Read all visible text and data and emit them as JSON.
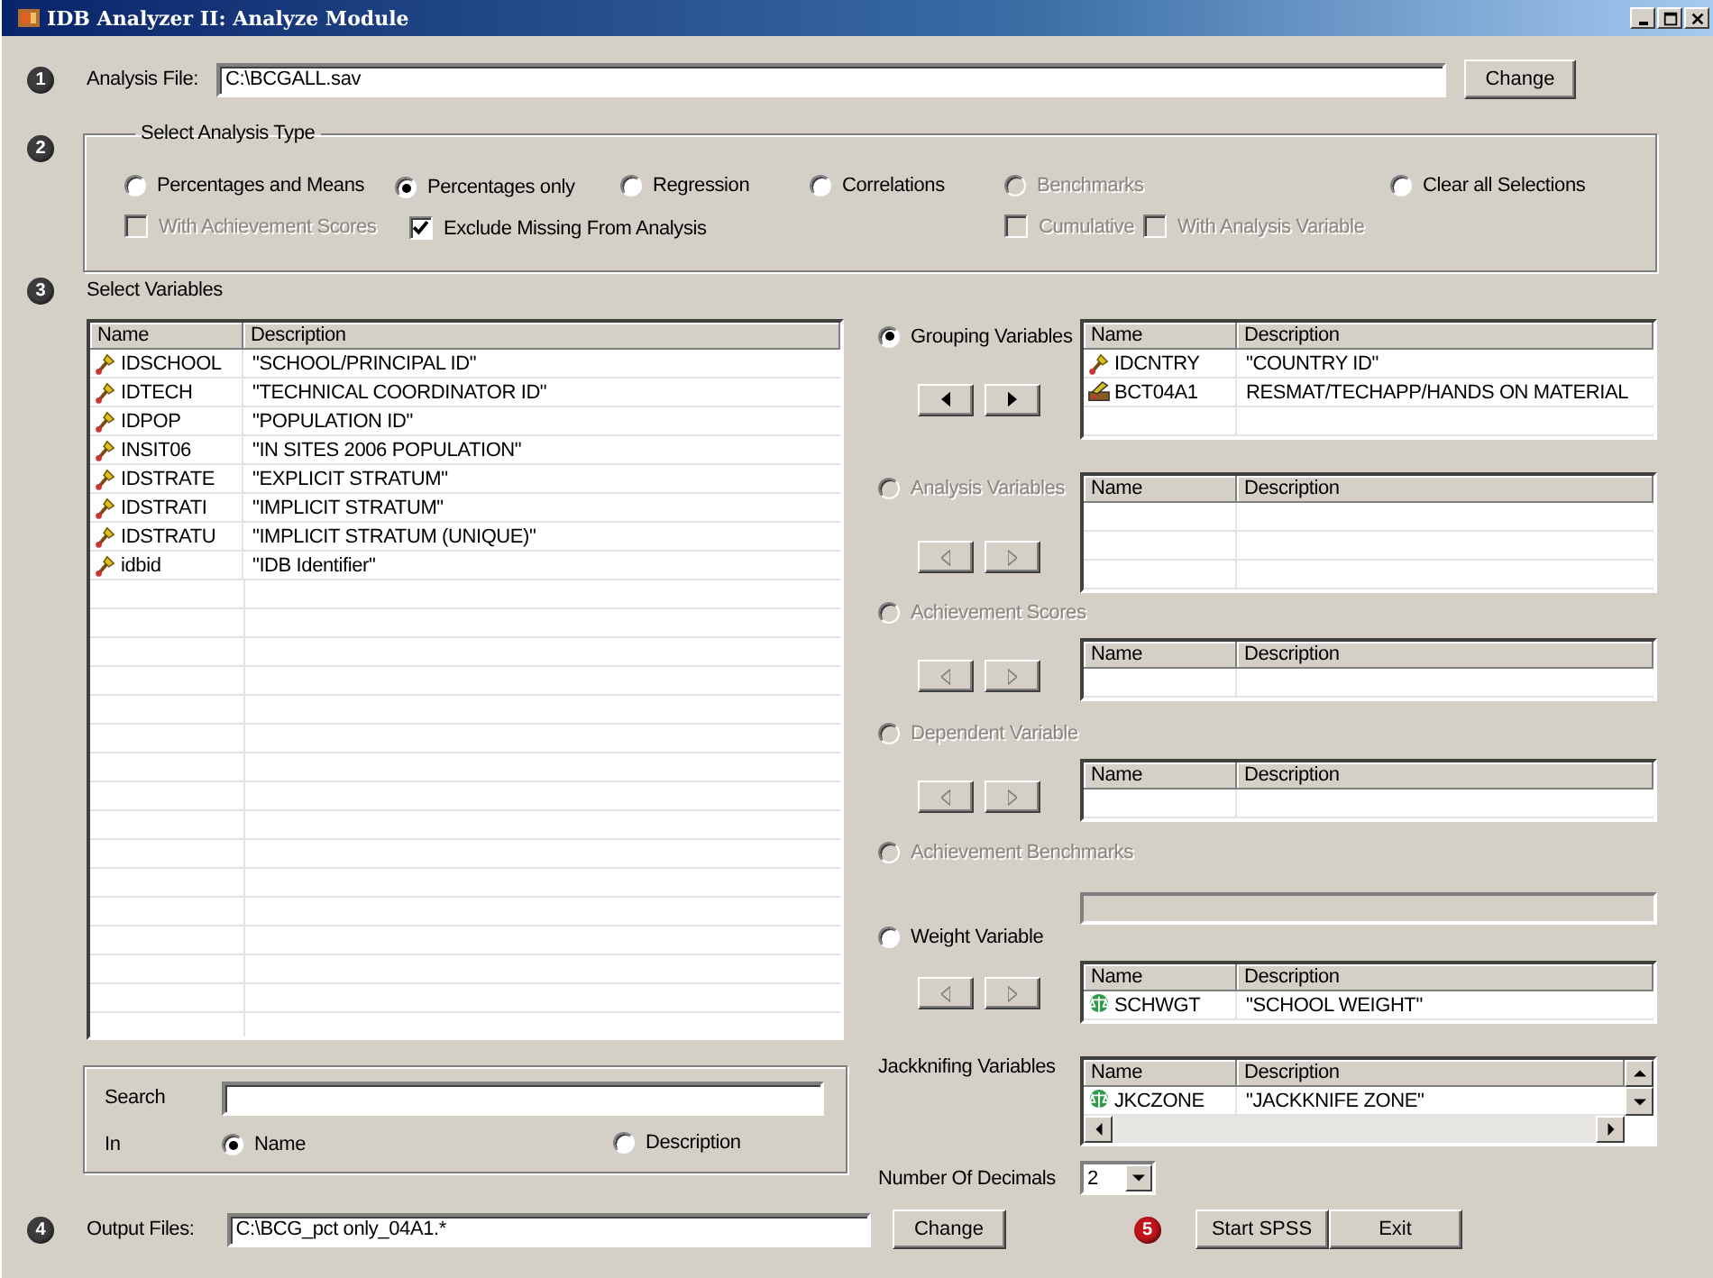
{
  "window": {
    "title": "IDB Analyzer II: Analyze Module"
  },
  "analysis_file": {
    "step": {
      "number": "1",
      "color": "#3c3c3c"
    },
    "label": "Analysis File:",
    "value": "C:\\BCGALL.sav",
    "button": "Change"
  },
  "analysis_type": {
    "step": {
      "number": "2",
      "color": "#3c3c3c"
    },
    "title": "Select Analysis Type",
    "options": [
      {
        "label": "Percentages and Means",
        "selected": false,
        "disabled": false
      },
      {
        "label": "Percentages only",
        "selected": true,
        "disabled": false
      },
      {
        "label": "Regression",
        "selected": false,
        "disabled": false
      },
      {
        "label": "Correlations",
        "selected": false,
        "disabled": false
      },
      {
        "label": "Benchmarks",
        "selected": false,
        "disabled": true
      },
      {
        "label": "Clear all Selections",
        "selected": false,
        "disabled": false
      }
    ],
    "checkboxes": [
      {
        "label": "With Achievement Scores",
        "checked": false,
        "disabled": true
      },
      {
        "label": "Exclude Missing From Analysis",
        "checked": true,
        "disabled": false
      },
      {
        "label": "Cumulative",
        "checked": false,
        "disabled": true
      },
      {
        "label": "With Analysis Variable",
        "checked": false,
        "disabled": true
      }
    ]
  },
  "select_variables": {
    "step": {
      "number": "3",
      "color": "#3c3c3c"
    },
    "title": "Select Variables",
    "columns": [
      "Name",
      "Description"
    ],
    "rows": [
      {
        "name": "IDSCHOOL",
        "description": "\"SCHOOL/PRINCIPAL ID\"",
        "kind": "id"
      },
      {
        "name": "IDTECH",
        "description": "\"TECHNICAL COORDINATOR ID\"",
        "kind": "id"
      },
      {
        "name": "IDPOP",
        "description": "\"POPULATION ID\"",
        "kind": "id"
      },
      {
        "name": "INSIT06",
        "description": "\"IN SITES 2006 POPULATION\"",
        "kind": "id"
      },
      {
        "name": "IDSTRATE",
        "description": "\"EXPLICIT STRATUM\"",
        "kind": "id"
      },
      {
        "name": "IDSTRATI",
        "description": "\"IMPLICIT STRATUM\"",
        "kind": "id"
      },
      {
        "name": "IDSTRATU",
        "description": "\"IMPLICIT STRATUM (UNIQUE)\"",
        "kind": "id"
      },
      {
        "name": "idbid",
        "description": "\"IDB Identifier\"",
        "kind": "id"
      }
    ],
    "search": {
      "label": "Search",
      "in_label": "In",
      "options": [
        {
          "label": "Name",
          "selected": true
        },
        {
          "label": "Description",
          "selected": false
        }
      ]
    }
  },
  "variable_groups": [
    {
      "kind": "table",
      "label": "Grouping Variables",
      "selected": true,
      "disabled": false,
      "columns": [
        "Name",
        "Description"
      ],
      "rows": [
        {
          "name": "IDCNTRY",
          "description": "\"COUNTRY ID\"",
          "kind": "id"
        },
        {
          "name": "BCT04A1",
          "description": "RESMAT/TECHAPP/HANDS ON MATERIAL",
          "kind": "categorical"
        }
      ]
    },
    {
      "kind": "table",
      "label": "Analysis Variables",
      "selected": false,
      "disabled": true,
      "columns": [
        "Name",
        "Description"
      ]
    },
    {
      "kind": "table",
      "label": "Achievement Scores",
      "selected": false,
      "disabled": true,
      "columns": [
        "Name",
        "Description"
      ]
    },
    {
      "kind": "table",
      "label": "Dependent Variable",
      "selected": false,
      "disabled": true,
      "columns": [
        "Name",
        "Description"
      ]
    },
    {
      "kind": "field",
      "label": "Achievement Benchmarks",
      "selected": false,
      "disabled": true
    },
    {
      "kind": "table",
      "label": "Weight Variable",
      "selected": false,
      "disabled": false,
      "arrows_disabled": true,
      "columns": [
        "Name",
        "Description"
      ],
      "rows": [
        {
          "name": "SCHWGT",
          "description": "\"SCHOOL WEIGHT\"",
          "kind": "weight"
        }
      ]
    },
    {
      "kind": "scroll_table",
      "label": "Jackknifing Variables",
      "columns": [
        "Name",
        "Description"
      ],
      "rows": [
        {
          "name": "JKCZONE",
          "description": "\"JACKKNIFE ZONE\"",
          "kind": "weight"
        }
      ]
    }
  ],
  "decimals": {
    "label": "Number Of Decimals",
    "value": "2"
  },
  "output_files": {
    "step": {
      "number": "4",
      "color": "#3c3c3c"
    },
    "label": "Output Files:",
    "value": "C:\\BCG_pct only_04A1.*",
    "button": "Change"
  },
  "run": {
    "step": {
      "number": "5",
      "color": "#c0141c"
    },
    "buttons": [
      "Start SPSS",
      "Exit"
    ]
  }
}
